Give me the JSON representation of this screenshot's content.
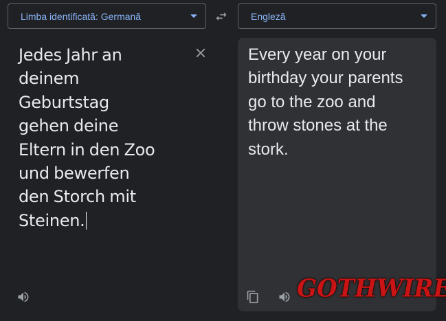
{
  "source": {
    "language_label": "Limba identificată: Germană",
    "text": "Jedes Jahr an\ndeinem\nGeburtstag\ngehen deine\nEltern in den Zoo\nund bewerfen\nden Storch mit\nSteinen."
  },
  "target": {
    "language_label": "Engleză",
    "text": "Every year on your\nbirthday your parents\ngo to the zoo and\nthrow stones at the\nstork."
  },
  "watermark": {
    "text": "GOTHWIRE"
  },
  "colors": {
    "background": "#202124",
    "panel": "#303134",
    "accent": "#8ab4f8",
    "text": "#e8eaed",
    "icon": "#9aa0a6",
    "watermark": "#c81414"
  },
  "icons": {
    "swap": "swap-horiz-icon",
    "clear": "close-icon",
    "speaker": "volume-up-icon",
    "copy": "content-copy-icon"
  }
}
